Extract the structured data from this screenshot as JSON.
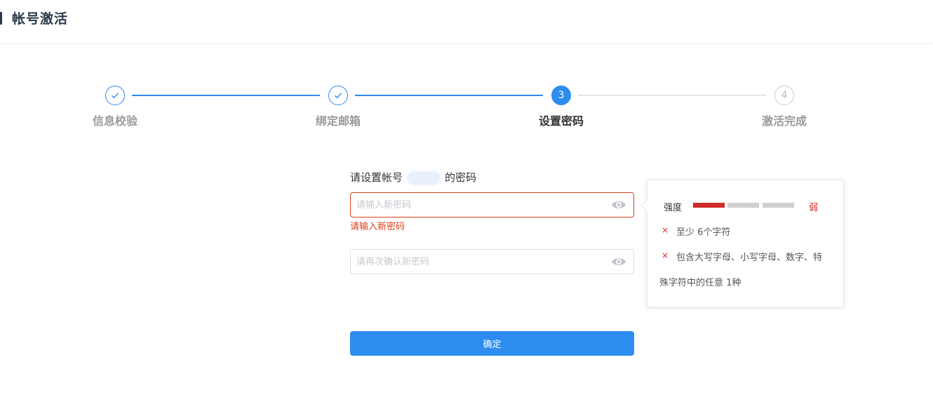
{
  "header": {
    "title": "帐号激活"
  },
  "steps": [
    {
      "label": "信息校验",
      "status": "done",
      "number": "1"
    },
    {
      "label": "绑定邮箱",
      "status": "done",
      "number": "2"
    },
    {
      "label": "设置密码",
      "status": "current",
      "number": "3"
    },
    {
      "label": "激活完成",
      "status": "todo",
      "number": "4"
    }
  ],
  "form": {
    "title_prefix": "请设置帐号",
    "title_suffix": "的密码",
    "new_password": {
      "value": "",
      "placeholder": "请输入新密码",
      "error": "请输入新密码"
    },
    "confirm_password": {
      "value": "",
      "placeholder": "请再次确认新密码"
    },
    "confirm_button": "确定"
  },
  "strength": {
    "label": "强度",
    "level": "弱",
    "filled_segments": 1,
    "total_segments": 3,
    "rules": [
      {
        "mark": "×",
        "text": "至少 6个字符",
        "met": false
      },
      {
        "mark": "×",
        "text_line1": "包含大写字母、小写字母、数字、特",
        "text_line2": "殊字符中的任意 1种",
        "met": false
      }
    ]
  },
  "colors": {
    "primary": "#2d8cf0",
    "error": "#d9421b",
    "weak": "#d12a2a",
    "inactive": "#cfcfcf"
  }
}
